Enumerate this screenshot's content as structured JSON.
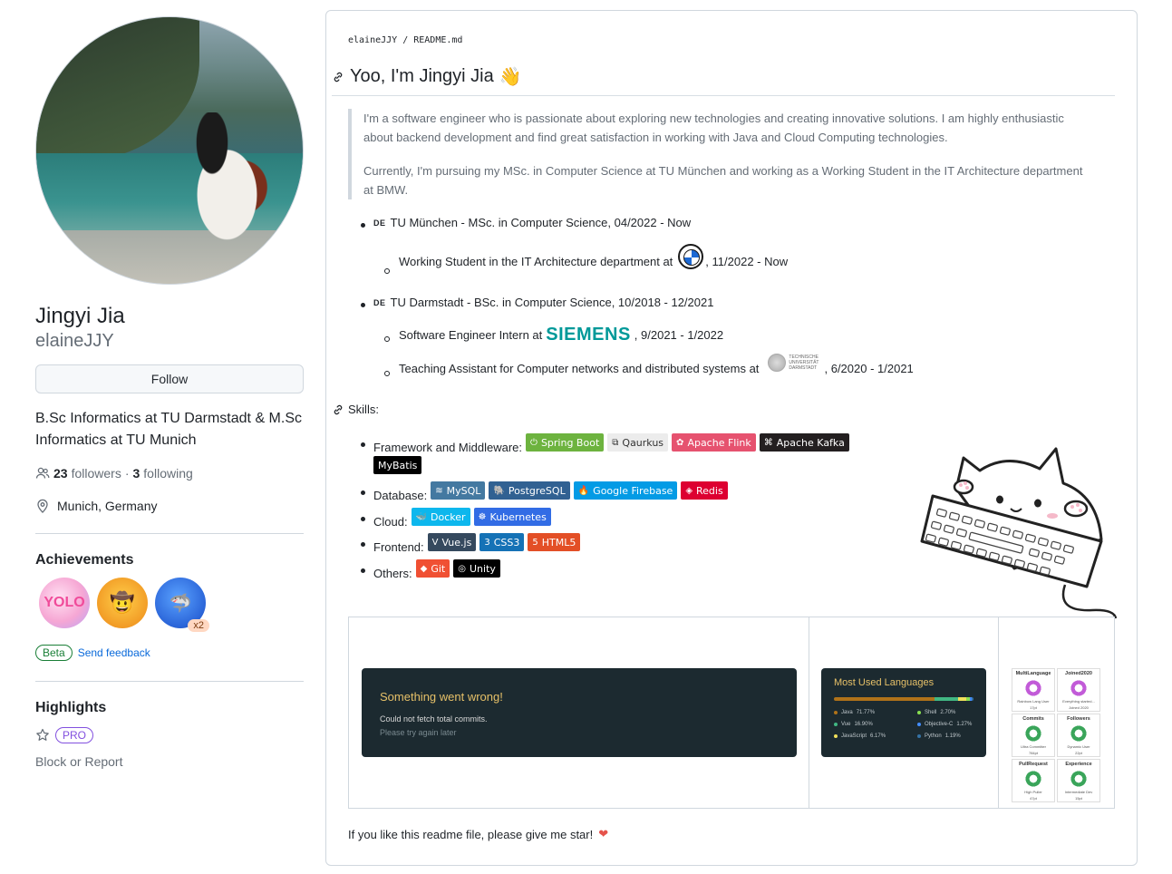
{
  "profile": {
    "name": "Jingyi Jia",
    "login": "elaineJJY",
    "follow_label": "Follow",
    "bio": "B.Sc Informatics at TU Darmstadt & M.Sc Informatics at TU Munich",
    "followers_count": "23",
    "followers_label": "followers",
    "separator": "·",
    "following_count": "3",
    "following_label": "following",
    "location": "Munich, Germany"
  },
  "achievements": {
    "title": "Achievements",
    "badges": [
      {
        "name": "yolo",
        "text": "YOLO"
      },
      {
        "name": "cowboy",
        "text": "🤠"
      },
      {
        "name": "shark",
        "text": "🦈",
        "count": "x2"
      }
    ],
    "beta_label": "Beta",
    "feedback_label": "Send feedback"
  },
  "highlights": {
    "title": "Highlights",
    "pro_label": "PRO",
    "block_label": "Block or Report"
  },
  "readme": {
    "crumb_user": "elaineJJY",
    "crumb_sep": " / ",
    "crumb_file": "README.md",
    "heading": "Yoo, I'm Jingyi Jia",
    "heading_emoji": "👋",
    "quote_p1": "I'm a software engineer who is passionate about exploring new technologies and creating innovative solutions. I am highly enthusiastic about backend development and find great satisfaction in working with Java and Cloud Computing technologies.",
    "quote_p2": "Currently, I'm pursuing my MSc. in Computer Science at TU München and working as a Working Student in the IT Architecture department at BMW.",
    "edu": {
      "flag": "DE",
      "tum": "TU München - MSc. in Computer Science, 04/2022 - Now",
      "bmw_before": "Working Student in the IT Architecture department at",
      "bmw_after": ", 11/2022 - Now",
      "tud": "TU Darmstadt - BSc. in Computer Science, 10/2018 - 12/2021",
      "siemens_before": "Software Engineer Intern at",
      "siemens_logo": "SIEMENS",
      "siemens_after": ", 9/2021 - 1/2022",
      "ta_before": "Teaching Assistant for Computer networks and distributed systems at",
      "tud_logo_line1": "TECHNISCHE",
      "tud_logo_line2": "UNIVERSITÄT",
      "tud_logo_line3": "DARMSTADT",
      "ta_after": ", 6/2020 - 1/2021"
    },
    "skills_title": "Skills:",
    "skills": {
      "framework_label": "Framework and Middleware:",
      "database_label": "Database:",
      "cloud_label": "Cloud:",
      "frontend_label": "Frontend:",
      "others_label": "Others:",
      "framework": [
        {
          "label": "Spring Boot",
          "color": "#6DB33F",
          "icon": "⏻"
        },
        {
          "label": "Qaurkus",
          "color": "#ececec",
          "text_color": "#333333",
          "icon": "⧉"
        },
        {
          "label": "Apache Flink",
          "color": "#E6526F",
          "icon": "✿"
        },
        {
          "label": "Apache Kafka",
          "color": "#231F20",
          "icon": "⌘"
        },
        {
          "label": "MyBatis",
          "color": "#000000",
          "icon": ""
        }
      ],
      "database": [
        {
          "label": "MySQL",
          "color": "#4479A1",
          "icon": "≋"
        },
        {
          "label": "PostgreSQL",
          "color": "#316192",
          "icon": "🐘"
        },
        {
          "label": "Google Firebase",
          "color": "#039BE5",
          "icon": "🔥"
        },
        {
          "label": "Redis",
          "color": "#DD0031",
          "icon": "◈"
        }
      ],
      "cloud": [
        {
          "label": "Docker",
          "color": "#0db7ed",
          "icon": "🐳"
        },
        {
          "label": "Kubernetes",
          "color": "#326ce5",
          "icon": "☸"
        }
      ],
      "frontend": [
        {
          "label": "Vue.js",
          "color": "#35495e",
          "icon": "V"
        },
        {
          "label": "CSS3",
          "color": "#1572B6",
          "icon": "3"
        },
        {
          "label": "HTML5",
          "color": "#E34F26",
          "icon": "5"
        }
      ],
      "others": [
        {
          "label": "Git",
          "color": "#F05033",
          "icon": "◆"
        },
        {
          "label": "Unity",
          "color": "#000000",
          "icon": "◎"
        }
      ]
    },
    "stats": {
      "error_title": "Something went wrong!",
      "error_line1": "Could not fetch total commits.",
      "error_line2": "Please try again later",
      "langs_title": "Most Used Languages",
      "languages": [
        {
          "name": "Java",
          "pct": "71.77%",
          "value": 71.77,
          "color": "#b07219"
        },
        {
          "name": "Shell",
          "pct": "2.70%",
          "value": 2.7,
          "color": "#89e051"
        },
        {
          "name": "Vue",
          "pct": "16.90%",
          "value": 16.9,
          "color": "#41b883"
        },
        {
          "name": "Objective-C",
          "pct": "1.27%",
          "value": 1.27,
          "color": "#438eff"
        },
        {
          "name": "JavaScript",
          "pct": "6.17%",
          "value": 6.17,
          "color": "#f1e05a"
        },
        {
          "name": "Python",
          "pct": "1.19%",
          "value": 1.19,
          "color": "#3572A5"
        }
      ],
      "trophies": [
        {
          "title": "MultiLanguage",
          "sub": "Rainbow Lang User",
          "pts": "17pt",
          "color": "#c25bd8"
        },
        {
          "title": "Joined2020",
          "sub": "Everything started...",
          "pts": "Joined 2020",
          "color": "#c25bd8"
        },
        {
          "title": "Commits",
          "sub": "Ultra Committer",
          "pts": "784pt",
          "color": "#3aa55a"
        },
        {
          "title": "Followers",
          "sub": "Dynamic User",
          "pts": "22pt",
          "color": "#3aa55a"
        },
        {
          "title": "PullRequest",
          "sub": "High Puller",
          "pts": "47pt",
          "color": "#3aa55a"
        },
        {
          "title": "Experience",
          "sub": "Intermediate Dev",
          "pts": "15pt",
          "color": "#3aa55a"
        }
      ]
    },
    "footer": "If you like this readme file, please give me star!",
    "footer_emoji": "❤"
  }
}
